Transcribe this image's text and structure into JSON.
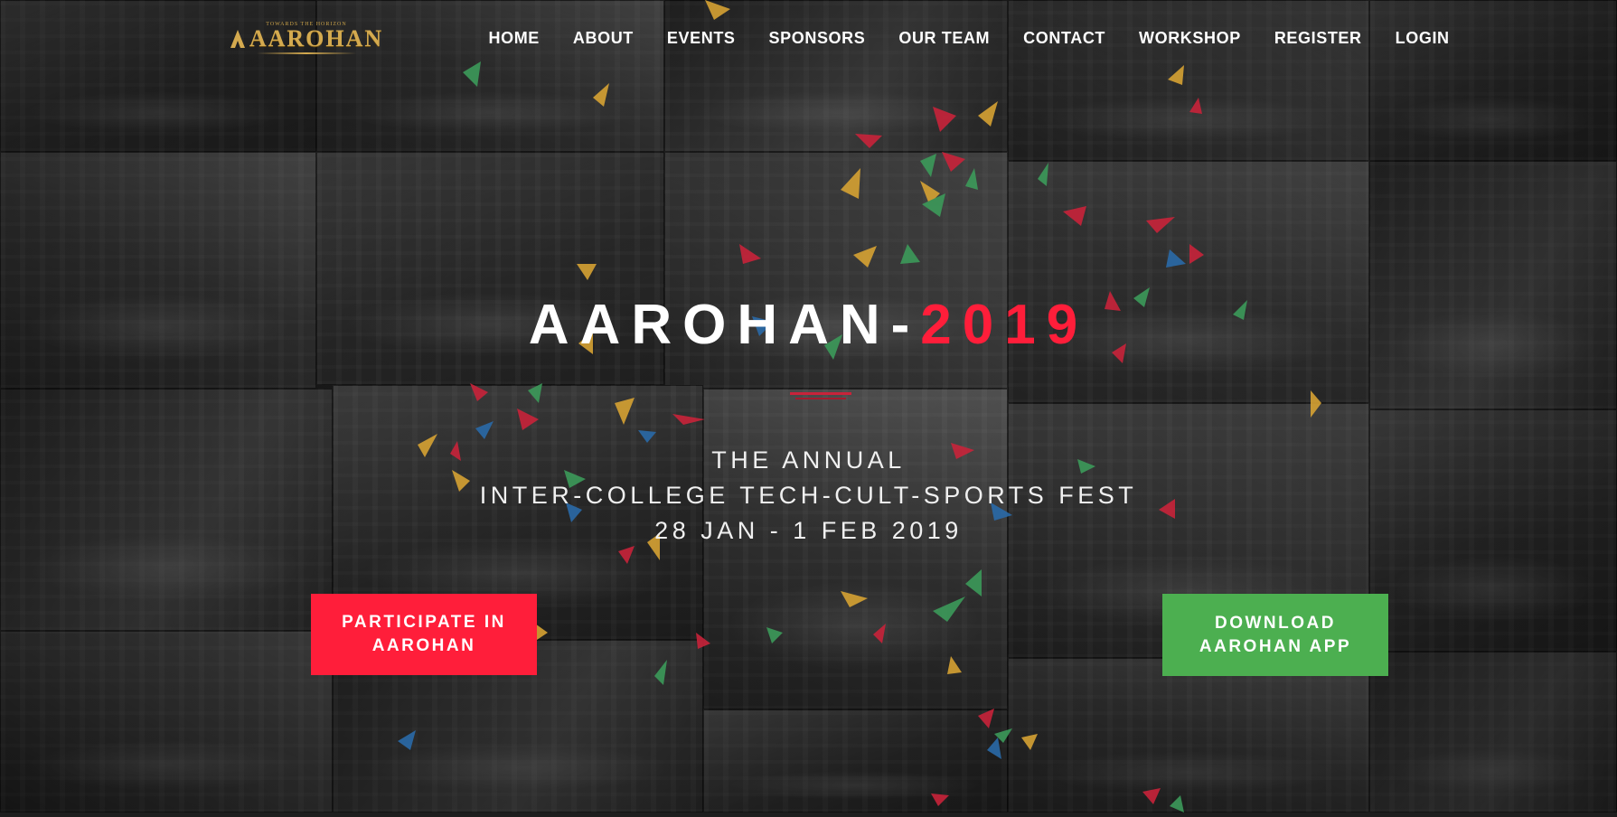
{
  "logo": {
    "tagline": "TOWARDS THE HORIZON",
    "text": "AAROHAN"
  },
  "nav": {
    "items": [
      "HOME",
      "ABOUT",
      "EVENTS",
      "SPONSORS",
      "OUR TEAM",
      "CONTACT",
      "WORKSHOP",
      "REGISTER",
      "LOGIN"
    ]
  },
  "hero": {
    "title_main": "AAROHAN-",
    "title_year": "2019",
    "line1": "THE ANNUAL",
    "line2": "INTER-COLLEGE TECH-CULT-SPORTS FEST",
    "line3": "28 JAN - 1 FEB 2019"
  },
  "buttons": {
    "participate": "PARTICIPATE IN AAROHAN",
    "download": "DOWNLOAD AAROHAN APP"
  },
  "colors": {
    "accent_red": "#ff1e3a",
    "accent_green": "#4caf50",
    "logo_gold": "#d4aa4f",
    "background": "#1e1e1e"
  }
}
